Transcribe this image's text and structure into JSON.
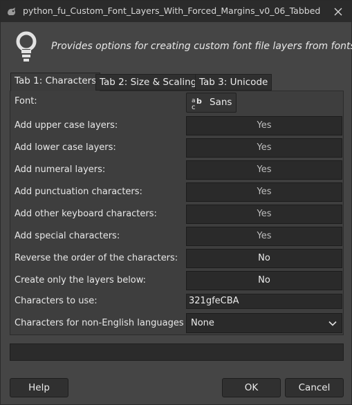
{
  "window": {
    "title": "python_fu_Custom_Font_Layers_With_Forced_Margins_v0_06_Tabbed"
  },
  "header": {
    "description": "Provides options for creating custom font file layers from fonts"
  },
  "tabs": [
    {
      "label": "Tab 1: Characters",
      "active": true
    },
    {
      "label": "Tab 2: Size & Scaling",
      "active": false
    },
    {
      "label": "Tab 3: Unicode",
      "active": false
    }
  ],
  "form": {
    "font": {
      "label": "Font:",
      "value": "Sans"
    },
    "upper": {
      "label": "Add upper case layers:",
      "value": "Yes"
    },
    "lower": {
      "label": "Add lower case layers:",
      "value": "Yes"
    },
    "numeral": {
      "label": "Add numeral layers:",
      "value": "Yes"
    },
    "punctuation": {
      "label": "Add punctuation characters:",
      "value": "Yes"
    },
    "keyboard": {
      "label": "Add other keyboard characters:",
      "value": "Yes"
    },
    "special": {
      "label": "Add special characters:",
      "value": "Yes"
    },
    "reverse": {
      "label": "Reverse the order of the characters:",
      "value": "No"
    },
    "only_below": {
      "label": "Create only the layers below:",
      "value": "No"
    },
    "chars_to_use": {
      "label": "Characters to use:",
      "value": "321gfeCBA"
    },
    "non_english": {
      "label": "Characters for non-English languages",
      "value": "None"
    }
  },
  "progress": {
    "fraction": 0
  },
  "buttons": {
    "help": "Help",
    "ok": "OK",
    "cancel": "Cancel"
  },
  "icons": {
    "title": "gimp-wilber-icon",
    "header": "lightbulb-icon",
    "font": "font-glyph-icon",
    "close": "close-icon",
    "dropdown": "chevron-down-icon"
  }
}
